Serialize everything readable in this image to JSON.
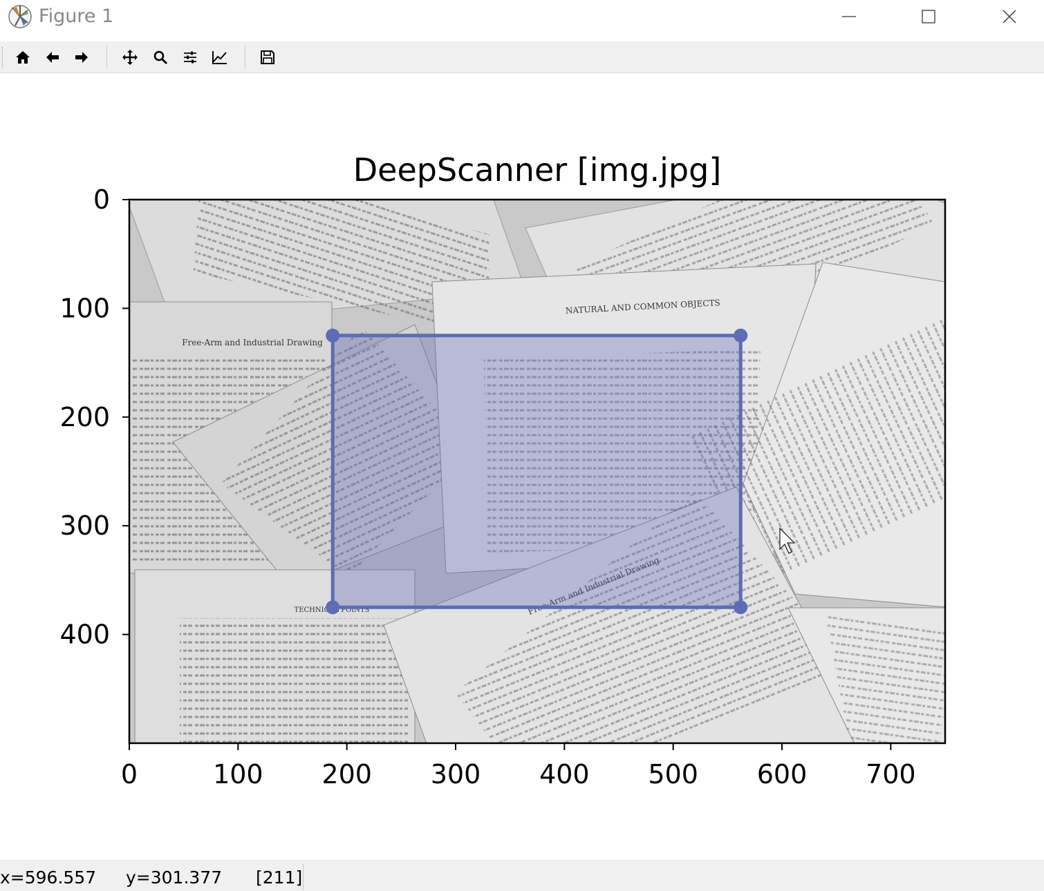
{
  "window": {
    "title": "Figure 1",
    "controls": [
      "minimize",
      "maximize",
      "close"
    ]
  },
  "toolbar": {
    "buttons": [
      {
        "icon": "home-icon",
        "label": "Home"
      },
      {
        "icon": "back-arrow-icon",
        "label": "Back"
      },
      {
        "icon": "forward-arrow-icon",
        "label": "Forward"
      },
      {
        "icon": "pan-icon",
        "label": "Pan"
      },
      {
        "icon": "zoom-icon",
        "label": "Zoom"
      },
      {
        "icon": "subplots-icon",
        "label": "Subplots"
      },
      {
        "icon": "edit-axis-icon",
        "label": "Customize"
      },
      {
        "icon": "save-icon",
        "label": "Save"
      }
    ]
  },
  "figure": {
    "title": "DeepScanner [img.jpg]"
  },
  "chart_data": {
    "type": "image",
    "title": "DeepScanner [img.jpg]",
    "xlim": [
      0,
      750
    ],
    "ylim": [
      500,
      0
    ],
    "xticks": [
      0,
      100,
      200,
      300,
      400,
      500,
      600,
      700
    ],
    "yticks": [
      0,
      100,
      200,
      300,
      400
    ],
    "selection_polygon": {
      "color": "#5e6bb5",
      "fill_opacity": 0.35,
      "points": [
        [
          187,
          125
        ],
        [
          562,
          125
        ],
        [
          562,
          375
        ],
        [
          187,
          375
        ]
      ]
    },
    "image_content": "grayscale photo of scattered open book pages",
    "printed_text": [
      "NATURAL AND COMMON OBJECTS",
      "Free-Arm and Industrial Drawing",
      "TECHNICAL POINTS",
      "Free-Arm and Industrial Drawing"
    ]
  },
  "status": {
    "x": "x=596.557",
    "y": "y=301.377",
    "value": "[211]"
  }
}
